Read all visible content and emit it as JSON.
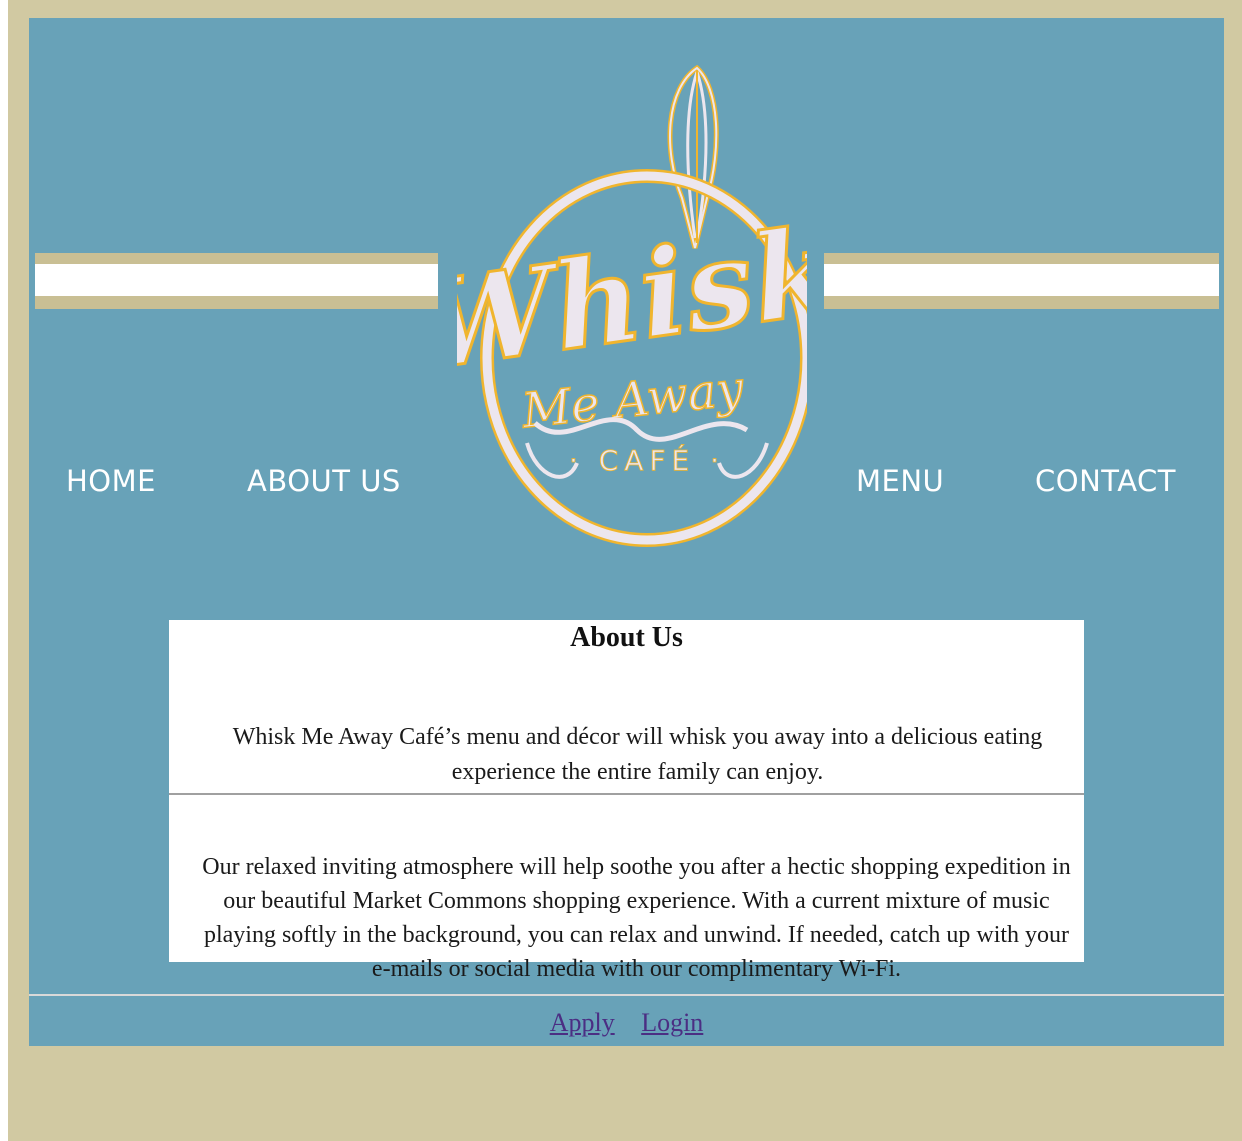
{
  "brand": {
    "logo_word": "Whisk",
    "logo_sub": "Me Away",
    "logo_cafe": "· CAFÉ ·"
  },
  "nav": {
    "home": "HOME",
    "about": "ABOUT US",
    "menu": "MENU",
    "contact": "CONTACT"
  },
  "about": {
    "heading": "About Us",
    "paragraph1": "Whisk Me Away Café’s menu and décor will whisk you away into a delicious eating experience the entire family can enjoy.",
    "paragraph2": "Our relaxed inviting atmosphere will help soothe you after a hectic shopping expedition in our beautiful Market Commons shopping experience. With a current mixture of music playing softly in the background, you can relax and unwind. If needed, catch up with your e-mails or social media with our complimentary Wi-Fi."
  },
  "footer": {
    "apply": "Apply",
    "login": "Login"
  },
  "colors": {
    "page_bg": "#d1c9a2",
    "site_bg": "#68a2b8",
    "logo_fill": "#ece6ee",
    "logo_outline": "#f0b52e",
    "link": "#4b2e83"
  }
}
